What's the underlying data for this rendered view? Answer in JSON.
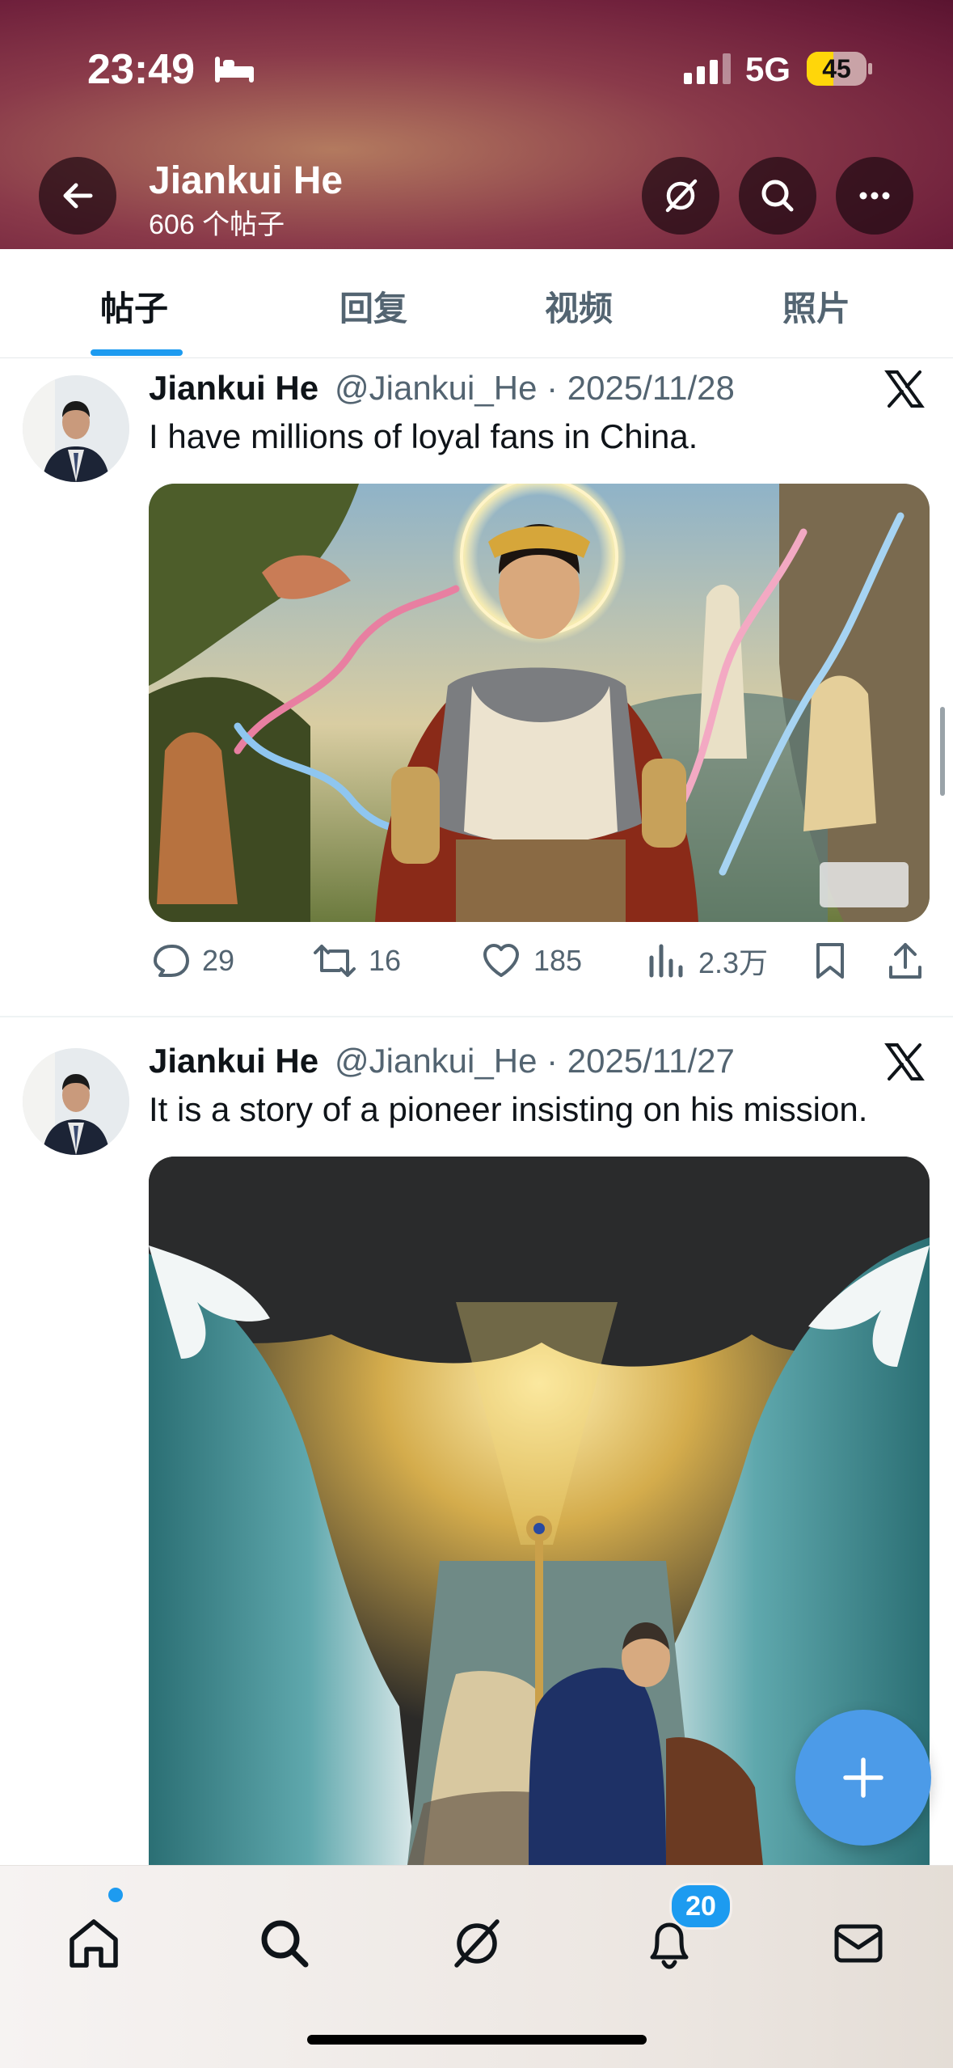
{
  "status_bar": {
    "time": "23:49",
    "network": "5G",
    "battery": "45",
    "battery_level": 0.45
  },
  "header": {
    "name": "Jiankui He",
    "post_count": "606 个帖子"
  },
  "tabs": [
    {
      "label": "帖子",
      "active": true
    },
    {
      "label": "回复",
      "active": false
    },
    {
      "label": "视频",
      "active": false
    },
    {
      "label": "照片",
      "active": false
    }
  ],
  "posts": [
    {
      "name": "Jiankui He",
      "handle": "@Jiankui_He",
      "separator": "·",
      "date": "2025/11/28",
      "text": "I have millions of loyal fans in China.",
      "replies": "29",
      "reposts": "16",
      "likes": "185",
      "views": "2.3万"
    },
    {
      "name": "Jiankui He",
      "handle": "@Jiankui_He",
      "separator": "·",
      "date": "2025/11/27",
      "text": "It is a story of a pioneer insisting on his mission."
    }
  ],
  "nav": {
    "notifications_badge": "20"
  },
  "colors": {
    "accent": "#1d9bf0",
    "fab": "#4c9be8",
    "header_bg": "#7a2a44"
  },
  "icons": [
    "back-arrow-icon",
    "grok-icon",
    "search-icon",
    "more-icon",
    "x-logo-icon",
    "reply-icon",
    "repost-icon",
    "like-icon",
    "views-icon",
    "bookmark-icon",
    "share-icon",
    "compose-plus-icon",
    "home-icon",
    "notifications-icon",
    "mail-icon"
  ]
}
